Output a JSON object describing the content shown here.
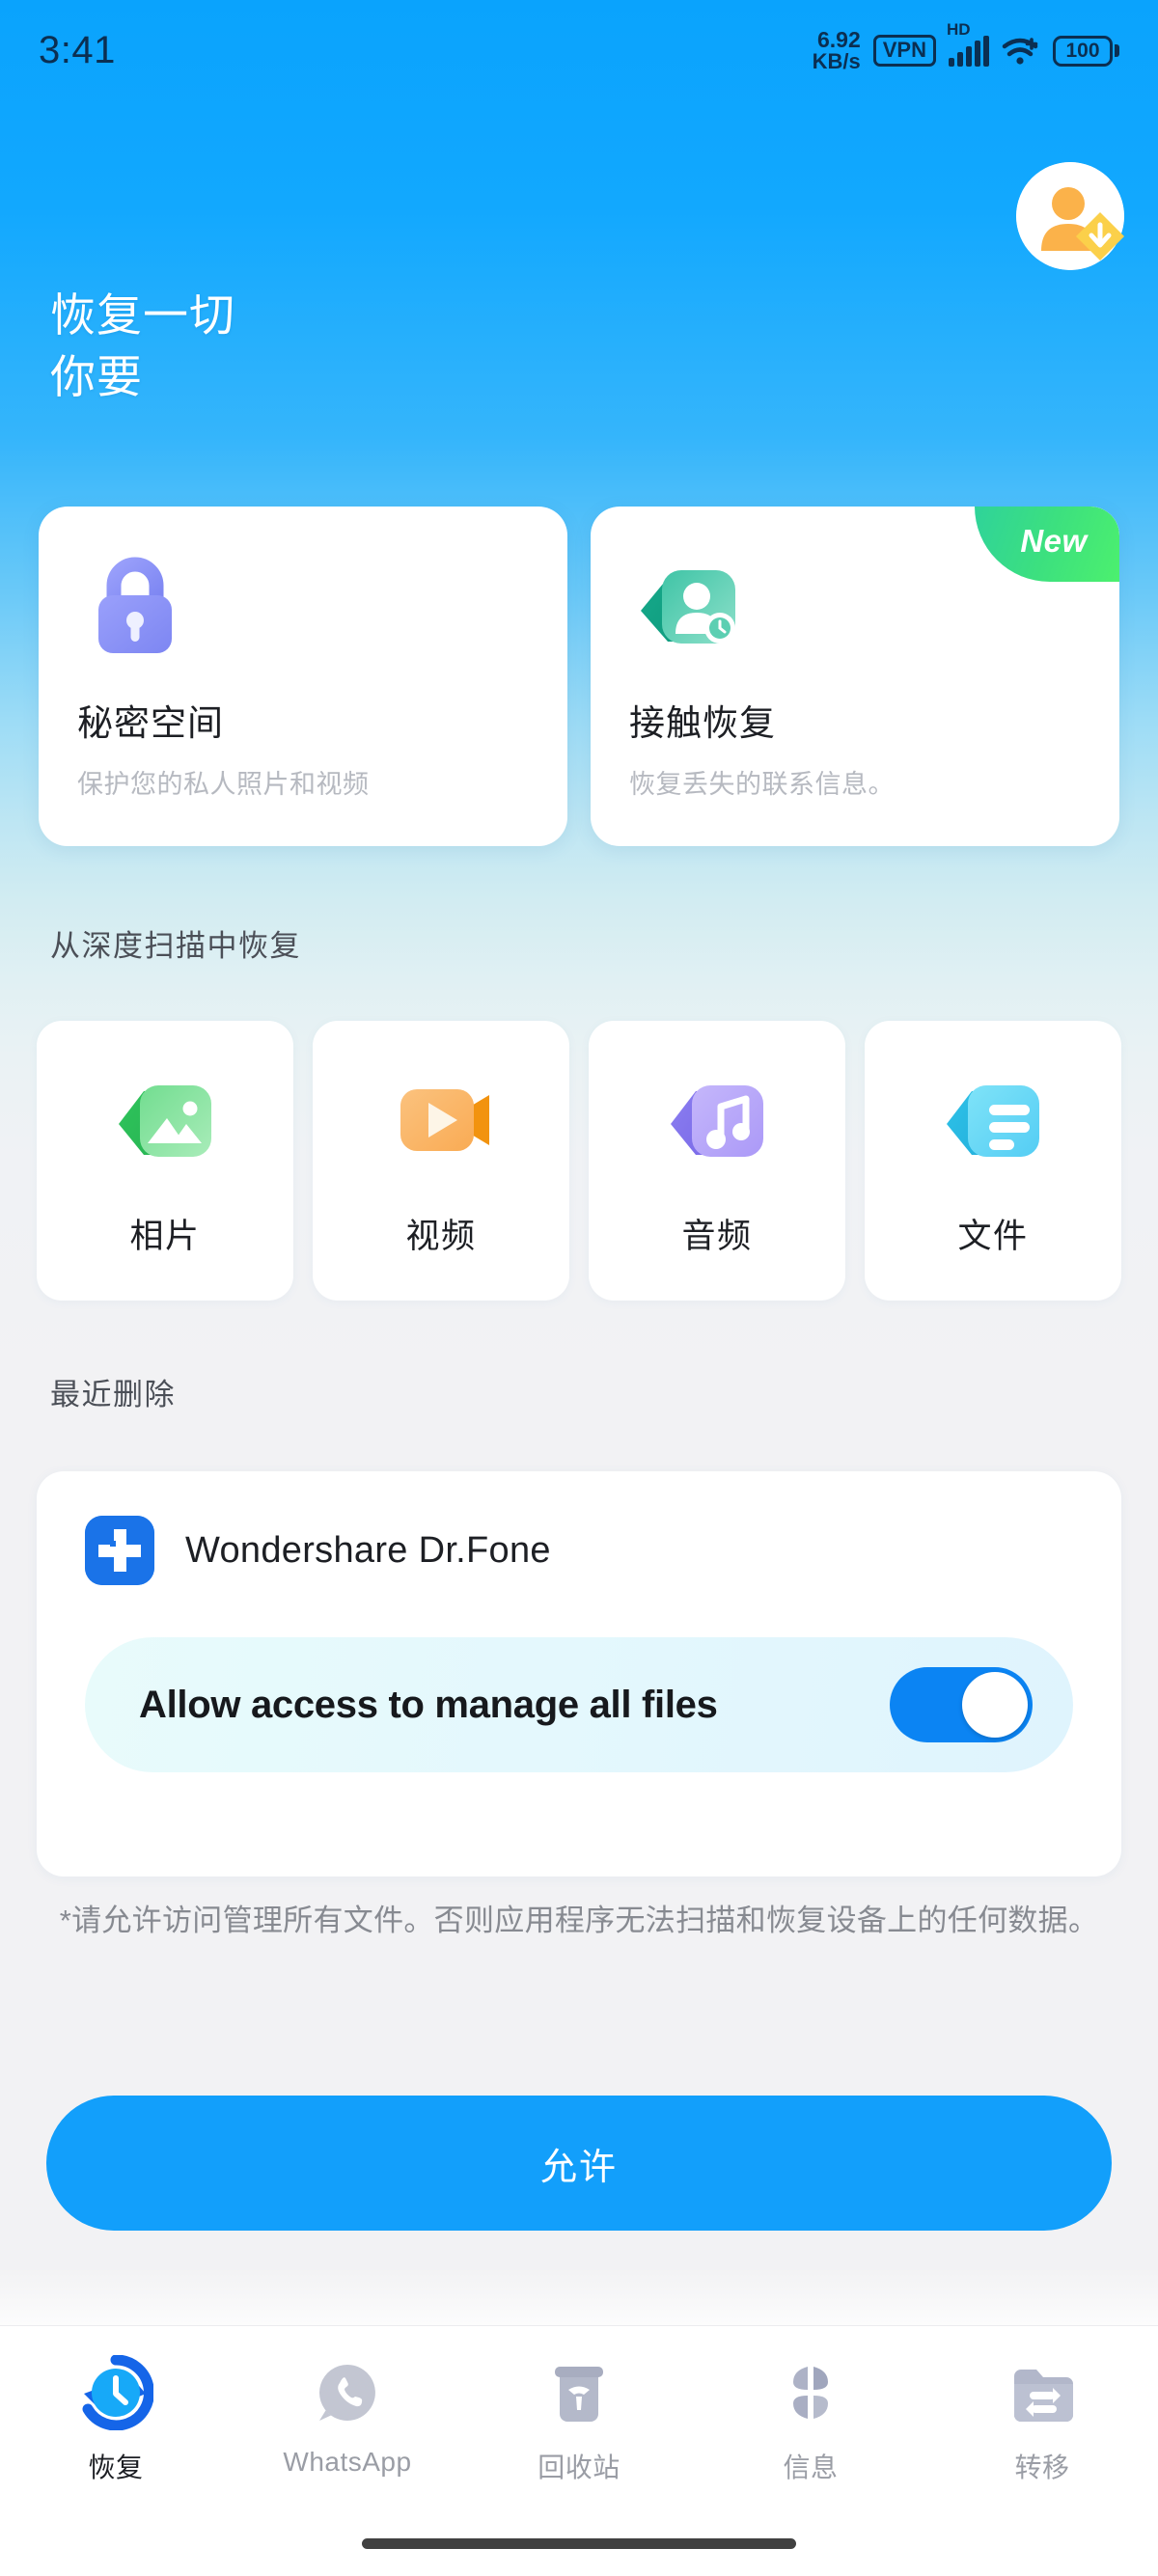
{
  "statusbar": {
    "time": "3:41",
    "net_speed_value": "6.92",
    "net_speed_unit": "KB/s",
    "vpn_label": "VPN",
    "hd_label": "HD",
    "battery_level": "100",
    "signal_icon": "signal-bars-icon",
    "wifi_icon": "wifi-plus-icon"
  },
  "header": {
    "avatar_icon": "user-avatar-icon",
    "avatar_badge_icon": "vip-download-badge-icon",
    "hero_line1": "恢复一切",
    "hero_line2": "你要"
  },
  "feature_cards": [
    {
      "icon": "lock-icon",
      "title": "秘密空间",
      "subtitle": "保护您的私人照片和视频",
      "badge": ""
    },
    {
      "icon": "contact-recovery-icon",
      "title": "接触恢复",
      "subtitle": "恢复丢失的联系信息。",
      "badge": "New"
    }
  ],
  "deep_scan": {
    "section_title": "从深度扫描中恢复",
    "items": [
      {
        "icon": "photo-icon",
        "label": "相片"
      },
      {
        "icon": "video-icon",
        "label": "视频"
      },
      {
        "icon": "audio-icon",
        "label": "音频"
      },
      {
        "icon": "file-icon",
        "label": "文件"
      }
    ]
  },
  "recent": {
    "section_title": "最近删除"
  },
  "permission": {
    "app_icon": "dr-fone-app-icon",
    "app_name": "Wondershare Dr.Fone",
    "toggle_label": "Allow access to manage all files",
    "toggle_state": "on",
    "disclaimer": "*请允许访问管理所有文件。否则应用程序无法扫描和恢复设备上的任何数据。",
    "cta_label": "允许"
  },
  "bottomnav": {
    "items": [
      {
        "icon": "recovery-clock-icon",
        "label": "恢复",
        "active": true
      },
      {
        "icon": "whatsapp-icon",
        "label": "WhatsApp",
        "active": false
      },
      {
        "icon": "trash-icon",
        "label": "回收站",
        "active": false
      },
      {
        "icon": "messages-flower-icon",
        "label": "信息",
        "active": false
      },
      {
        "icon": "transfer-folder-icon",
        "label": "转移",
        "active": false
      }
    ]
  },
  "colors": {
    "accent_blue": "#129ffb",
    "toggle_blue": "#0b84f3",
    "new_badge_green": "#3ce07f",
    "lock_purple": "#8a90f5",
    "photo_green": "#6fd98a",
    "video_orange": "#f8b45f",
    "audio_purple": "#b9a9f7",
    "file_cyan": "#6fd9f5",
    "app_icon_blue": "#1a73e8"
  }
}
